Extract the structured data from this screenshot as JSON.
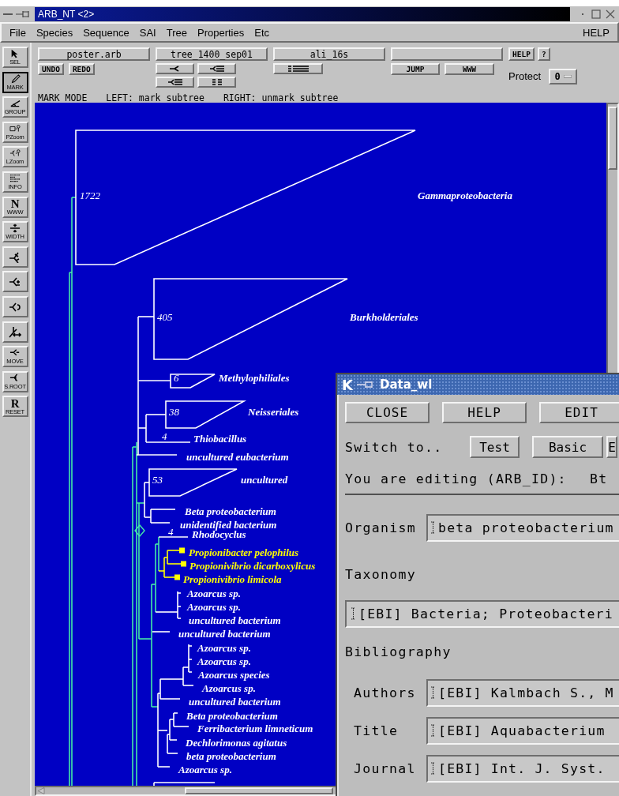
{
  "window": {
    "title": "ARB_NT <2>"
  },
  "menu": [
    {
      "label": "File"
    },
    {
      "label": "Species"
    },
    {
      "label": "Sequence"
    },
    {
      "label": "SAI"
    },
    {
      "label": "Tree"
    },
    {
      "label": "Properties"
    },
    {
      "label": "Etc"
    }
  ],
  "menu_help": "HELP",
  "header": {
    "fields": [
      "poster.arb",
      "tree_1400_sep01",
      "ali_16s"
    ],
    "help": "HELP",
    "question": "?",
    "undo": "UNDO",
    "redo": "REDO",
    "jump": "JUMP",
    "www": "WWW",
    "protect_label": "Protect",
    "protect_value": "0"
  },
  "mode_line": {
    "mode": "MARK MODE",
    "left": "LEFT: mark subtree",
    "right": "RIGHT: unmark subtree"
  },
  "tools": [
    {
      "label": "SEL",
      "selected": false
    },
    {
      "label": "MARK",
      "selected": true
    },
    {
      "label": "GROUP",
      "selected": false
    },
    {
      "label": "PZoom",
      "selected": false
    },
    {
      "label": "LZoom",
      "selected": false
    },
    {
      "label": "INFO",
      "selected": false
    },
    {
      "glyph": "N",
      "label": "WWW",
      "selected": false
    },
    {
      "label": "WIDTH",
      "selected": false
    },
    {
      "selected": false
    },
    {
      "selected": false
    },
    {
      "selected": false
    },
    {
      "selected": false
    },
    {
      "label": "MOVE",
      "selected": false
    },
    {
      "label": "S.ROOT",
      "selected": false
    },
    {
      "glyph": "R",
      "label": "RESET",
      "selected": false
    }
  ],
  "tree": {
    "nodes": [
      {
        "kind": "group",
        "label": "Gammaproteobacteria",
        "count": "1722",
        "marked": false
      },
      {
        "kind": "group",
        "label": "Burkholderiales",
        "count": "405",
        "marked": false
      },
      {
        "kind": "group",
        "label": "Methylophiliales",
        "count": "6",
        "marked": false
      },
      {
        "kind": "group",
        "label": "Neisseriales",
        "count": "38",
        "marked": false
      },
      {
        "kind": "flat",
        "label": "Thiobacillus",
        "count": "4",
        "marked": false
      },
      {
        "kind": "leaf",
        "label": "uncultured eubacterium",
        "marked": false
      },
      {
        "kind": "group",
        "label": "uncultured",
        "count": "53",
        "marked": false
      },
      {
        "kind": "leaf",
        "label": "Beta proteobacterium",
        "marked": false
      },
      {
        "kind": "leaf",
        "label": "unidentified bacterium",
        "marked": false
      },
      {
        "kind": "flat",
        "label": "Rhodocyclus",
        "count": "4",
        "marked": false
      },
      {
        "kind": "leaf",
        "label": "Propionibacter pelophilus",
        "marked": true
      },
      {
        "kind": "leaf",
        "label": "Propionivibrio dicarboxylicus",
        "marked": true
      },
      {
        "kind": "leaf",
        "label": "Propionivibrio limicola",
        "marked": true
      },
      {
        "kind": "leaf",
        "label": "Azoarcus sp.",
        "marked": false
      },
      {
        "kind": "leaf",
        "label": "Azoarcus sp.",
        "marked": false
      },
      {
        "kind": "leaf",
        "label": "uncultured bacterium",
        "marked": false
      },
      {
        "kind": "leaf",
        "label": "uncultured bacterium",
        "marked": false
      },
      {
        "kind": "leaf",
        "label": "Azoarcus sp.",
        "marked": false
      },
      {
        "kind": "leaf",
        "label": "Azoarcus sp.",
        "marked": false
      },
      {
        "kind": "leaf",
        "label": "Azoarcus species",
        "marked": false
      },
      {
        "kind": "leaf",
        "label": "Azoarcus sp.",
        "marked": false
      },
      {
        "kind": "leaf",
        "label": "uncultured bacterium",
        "marked": false
      },
      {
        "kind": "leaf",
        "label": "Beta proteobacterium",
        "marked": false
      },
      {
        "kind": "leaf",
        "label": "Ferribacterium limneticum",
        "marked": false
      },
      {
        "kind": "leaf",
        "label": "Dechlorimonas agitatus",
        "marked": false
      },
      {
        "kind": "leaf",
        "label": "beta proteobacterium",
        "marked": false
      },
      {
        "kind": "leaf",
        "label": "Azoarcus sp.",
        "marked": false
      }
    ]
  },
  "data_window": {
    "app_letter": "K",
    "title": "Data_wl",
    "buttons": [
      "CLOSE",
      "HELP",
      "EDIT"
    ],
    "switch_label": "Switch to..",
    "switch_buttons": [
      "Test",
      "Basic",
      "E"
    ],
    "editing_label": "You are editing (ARB_ID):",
    "editing_value": "Bt",
    "rows": [
      {
        "kind": "inline",
        "label": "Organism",
        "value": "beta proteobacterium"
      },
      {
        "kind": "heading",
        "label": "Taxonomy"
      },
      {
        "kind": "wide",
        "value": "[EBI] Bacteria; Proteobacteri"
      },
      {
        "kind": "heading",
        "label": "Bibliography"
      },
      {
        "kind": "sub",
        "label": "Authors",
        "value": "[EBI] Kalmbach S., M"
      },
      {
        "kind": "sub",
        "label": "Title",
        "value": "[EBI] Aquabacterium"
      },
      {
        "kind": "sub",
        "label": "Journal",
        "value": "[EBI] Int. J. Syst."
      }
    ]
  }
}
